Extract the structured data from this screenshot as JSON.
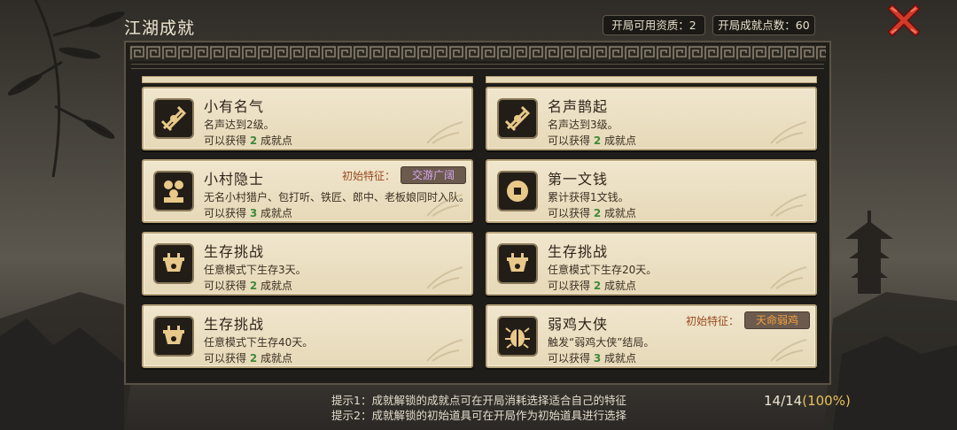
{
  "header": {
    "title": "江湖成就",
    "aptitude": "开局可用资质：2",
    "points": "开局成就点数：60"
  },
  "colors": {
    "reward_number": "#3f8a3a",
    "trait_label": "#9a4a20",
    "progress_percent": "#e8c25a"
  },
  "cards": [
    {
      "title": "小有名气",
      "desc": "名声达到2级。",
      "reward_prefix": "可以获得",
      "reward_num": "2",
      "reward_suffix": "成就点",
      "icon": "sword-emblem-icon"
    },
    {
      "title": "名声鹊起",
      "desc": "名声达到3级。",
      "reward_prefix": "可以获得",
      "reward_num": "2",
      "reward_suffix": "成就点",
      "icon": "sword-emblem-icon"
    },
    {
      "title": "小村隐士",
      "desc": "无名小村猎户、包打听、铁匠、郎中、老板娘同时入队。",
      "reward_prefix": "可以获得",
      "reward_num": "3",
      "reward_suffix": "成就点",
      "icon": "villagers-icon",
      "trait_label": "初始特征：",
      "trait": "交游广阔",
      "trait_color": "#d7a7f0"
    },
    {
      "title": "第一文钱",
      "desc": "累计获得1文钱。",
      "reward_prefix": "可以获得",
      "reward_num": "2",
      "reward_suffix": "成就点",
      "icon": "coin-icon"
    },
    {
      "title": "生存挑战",
      "desc": "任意模式下生存3天。",
      "reward_prefix": "可以获得",
      "reward_num": "2",
      "reward_suffix": "成就点",
      "icon": "cauldron-icon"
    },
    {
      "title": "生存挑战",
      "desc": "任意模式下生存20天。",
      "reward_prefix": "可以获得",
      "reward_num": "2",
      "reward_suffix": "成就点",
      "icon": "cauldron-icon"
    },
    {
      "title": "生存挑战",
      "desc": "任意模式下生存40天。",
      "reward_prefix": "可以获得",
      "reward_num": "2",
      "reward_suffix": "成就点",
      "icon": "cauldron-icon"
    },
    {
      "title": "弱鸡大侠",
      "desc": "触发“弱鸡大侠”结局。",
      "reward_prefix": "可以获得",
      "reward_num": "3",
      "reward_suffix": "成就点",
      "icon": "beetle-icon",
      "trait_label": "初始特征：",
      "trait": "天命弱鸡",
      "trait_color": "#f0a040"
    }
  ],
  "hints": [
    "提示1：成就解锁的成就点可在开局消耗选择适合自己的特征",
    "提示2：成就解锁的初始道具可在开局作为初始道具进行选择"
  ],
  "progress": {
    "count": "14/14",
    "percent": "(100%)"
  }
}
